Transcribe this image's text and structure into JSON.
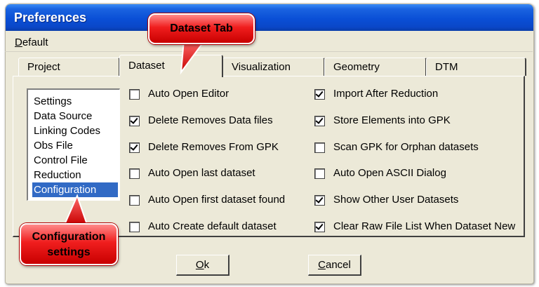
{
  "window": {
    "title": "Preferences"
  },
  "menu": {
    "default_label": "Default",
    "default_mnemonic": "D",
    "default_rest": "efault"
  },
  "tabs": [
    {
      "label": "Project",
      "active": false
    },
    {
      "label": "Dataset",
      "active": true
    },
    {
      "label": "Visualization",
      "active": false
    },
    {
      "label": "Geometry",
      "active": false
    },
    {
      "label": "DTM",
      "active": false
    }
  ],
  "list": {
    "items": [
      "Settings",
      "Data Source",
      "Linking Codes",
      "Obs File",
      "Control File",
      "Reduction",
      "Configuration"
    ],
    "selected": "Configuration"
  },
  "options_left": [
    {
      "label": "Auto Open Editor",
      "checked": false
    },
    {
      "label": "Delete Removes Data files",
      "checked": true
    },
    {
      "label": "Delete Removes From GPK",
      "checked": true
    },
    {
      "label": "Auto Open last dataset",
      "checked": false
    },
    {
      "label": "Auto Open first dataset found",
      "checked": false
    },
    {
      "label": "Auto Create default dataset",
      "checked": false
    }
  ],
  "options_right": [
    {
      "label": "Import After Reduction",
      "checked": true
    },
    {
      "label": "Store Elements into GPK",
      "checked": true
    },
    {
      "label": "Scan GPK for Orphan datasets",
      "checked": false
    },
    {
      "label": "Auto Open ASCII Dialog",
      "checked": false
    },
    {
      "label": "Show Other User Datasets",
      "checked": true
    },
    {
      "label": "Clear Raw File List When Dataset New",
      "checked": true
    }
  ],
  "buttons": {
    "ok_mnemonic": "O",
    "ok_rest": "k",
    "cancel_mnemonic": "C",
    "cancel_rest": "ancel"
  },
  "callouts": {
    "dataset_tab": "Dataset Tab",
    "config_line1": "Configuration",
    "config_line2": "settings"
  },
  "colors": {
    "titlebar": "#0a4fd6",
    "dialog_bg": "#ece9d8",
    "selection": "#316ac5",
    "callout": "#e41414"
  }
}
